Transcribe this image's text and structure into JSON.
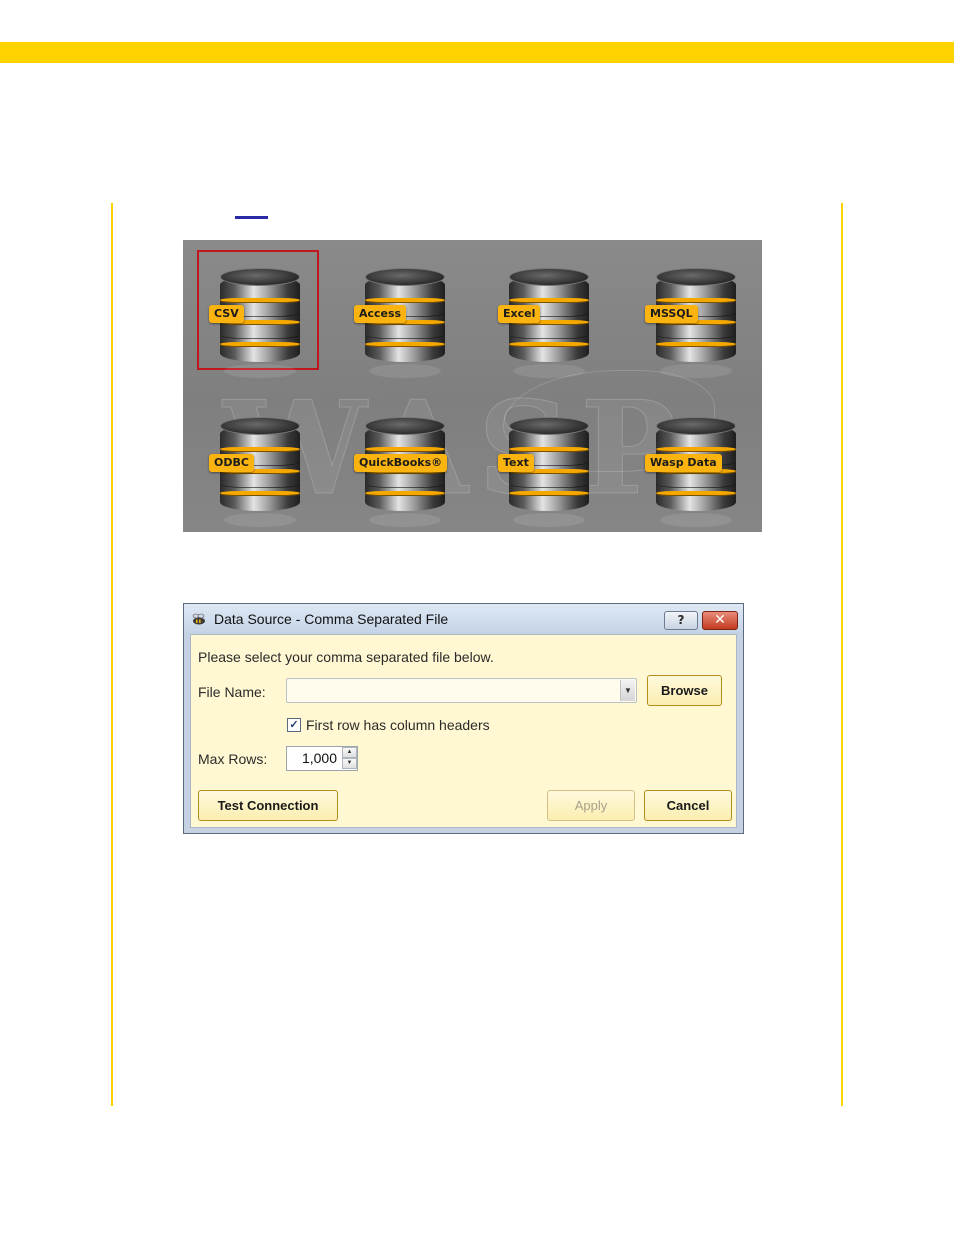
{
  "data_sources": {
    "tiles": [
      {
        "label": "CSV",
        "selected": true
      },
      {
        "label": "Access",
        "selected": false
      },
      {
        "label": "Excel",
        "selected": false
      },
      {
        "label": "MSSQL",
        "selected": false
      },
      {
        "label": "ODBC",
        "selected": false
      },
      {
        "label": "QuickBooks®",
        "selected": false
      },
      {
        "label": "Text",
        "selected": false
      },
      {
        "label": "Wasp Data",
        "selected": false
      }
    ]
  },
  "dialog": {
    "title": "Data Source - Comma Separated File",
    "help_symbol": "?",
    "close_symbol": "✕",
    "instruction": "Please select your comma separated file below.",
    "file_name_label": "File Name:",
    "file_name_value": "",
    "browse_label": "Browse",
    "first_row_checkbox_label": "First row has column headers",
    "first_row_checked": true,
    "max_rows_label": "Max Rows:",
    "max_rows_value": "1,000",
    "test_connection_label": "Test Connection",
    "apply_label": "Apply",
    "apply_enabled": false,
    "cancel_label": "Cancel"
  },
  "colors": {
    "accent": "#ffd200",
    "tile_label": "#fbb40f",
    "selection_outline": "#c0171e",
    "dialog_client": "#fff8d2"
  }
}
